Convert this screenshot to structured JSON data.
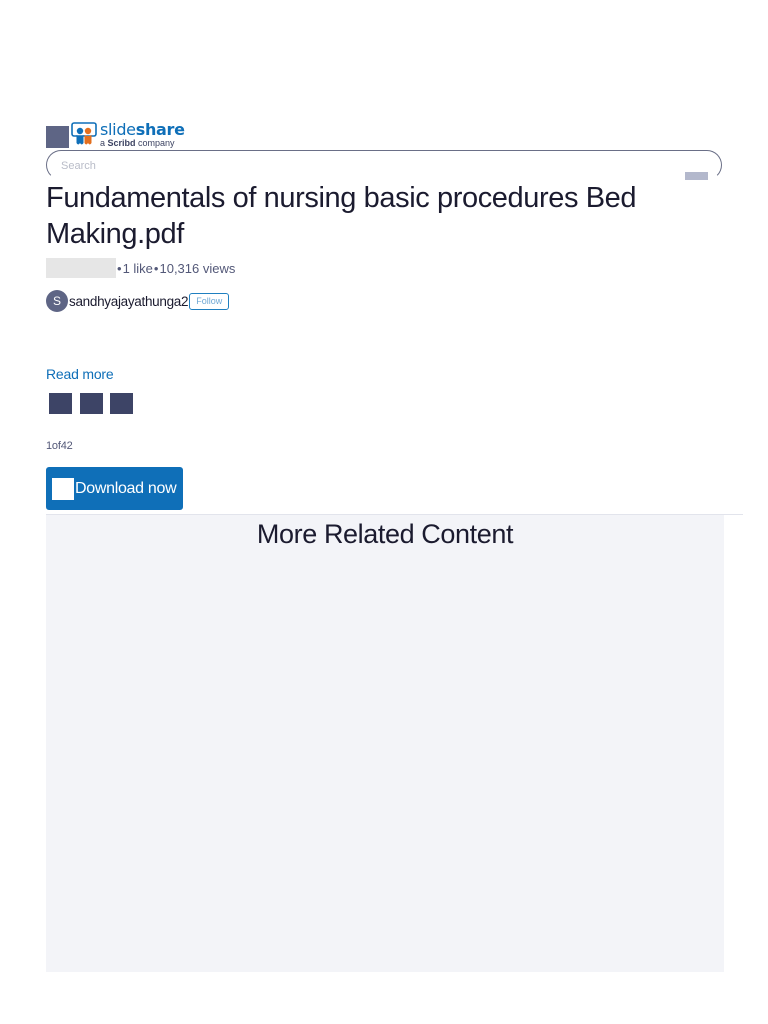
{
  "header": {
    "logo_word_light": "slide",
    "logo_word_bold": "share",
    "logo_tagline_prefix": "a ",
    "logo_tagline_brand": "Scribd",
    "logo_tagline_suffix": " company",
    "search_placeholder": "Search"
  },
  "document": {
    "title": "Fundamentals of nursing basic procedures Bed Making.pdf",
    "likes": "1 like",
    "views": "10,316 views",
    "separator": "•",
    "author_initial": "S",
    "author_name": "sandhyajayathunga2",
    "follow_label": "Follow",
    "read_more_label": "Read more",
    "page_counter": "1of42",
    "download_label": "Download now"
  },
  "related": {
    "title": "More Related Content"
  },
  "colors": {
    "brand_blue": "#0f6fb8",
    "dark_slate": "#3d4466",
    "related_bg": "#f3f4f8"
  }
}
